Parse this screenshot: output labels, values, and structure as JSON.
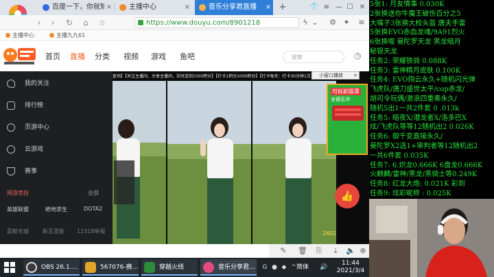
{
  "browser": {
    "tabs": [
      {
        "label": "百度一下，你就知道",
        "active": false
      },
      {
        "label": "主播中心",
        "active": false
      },
      {
        "label": "音乐分享君直播",
        "active": true
      }
    ],
    "close_glyph": "×",
    "new_tab_glyph": "+",
    "url": "https://www.douyu.com/8901218",
    "bookmarks": [
      "主播中心",
      "主播九九61"
    ]
  },
  "site": {
    "nav": [
      "首页",
      "直播",
      "分类",
      "视频",
      "游戏",
      "鱼吧"
    ],
    "active_nav": "直播",
    "search_placeholder": "搜索",
    "accent_color": "#ff5d23"
  },
  "sidebar": {
    "items": [
      "我的关注",
      "排行榜",
      "页游中心",
      "云游戏",
      "赛事"
    ],
    "section_title": "网游竞技",
    "section_all": "全部",
    "games": [
      "英雄联盟",
      "绝地求生",
      "DOTA2"
    ],
    "footer": [
      "蓝鲸长城",
      "斯瓦里斯",
      "12318举报"
    ]
  },
  "player": {
    "danmu": "查询】【关注主播间，分享主播间，实时送到1000积分】【打卡1积分1000积分】【打卡每天：打卡30分钟1次】【打卡每天分享",
    "mini_window_label": "小窗口播放",
    "ad_title": "可拆卸面罩",
    "ad_sub": "全键无冲",
    "rank_badge": "2602"
  },
  "task_panel": {
    "lines": [
      "5张1: 月友情事 0.030K",
      "2张换送你牛魔王破伤百分之5",
      "大嘴子3张换大校头盔 唐夫手雷",
      "5张换EVO赤血龙魂/9A91烈火",
      "6张换噬 曼陀罗天龙 黑龙暗月",
      "秘银天龙",
      "任务2: 荣耀铁骑 0.088K",
      "任务3: 雷神精月皮肤 0.100K",
      "任务4: EVO翔云永久+随机闪光弹",
      "飞虎队/唐刀盛世太平/cop赤龙/",
      "胡司令玩偶/激浪四重奏永久/",
      "随机5出1一共2件套 0 .013k",
      "任务5: 暗夜X/潜龙者X/洛多巴X",
      "炫/飞虎队等等12随机出2 0.026K",
      "任务6: 御千变直接永久/",
      "曼陀罗X2选1+审判者等12随机出2",
      "一共6件套 0.035K",
      "任务7: 6.炽龙0.666K 6盘龙0.666K",
      "火麒麟/雷神/黑龙/黑骑士等0.249K",
      "任务8: 红龙大炮: 0.021K 彩到",
      "任务9: 炫彩昵称 : 0.025K"
    ],
    "text_color": "#27e23a"
  },
  "taskbar": {
    "apps": [
      {
        "label": "OBS 26.1.…",
        "color": "#3a3a3a"
      },
      {
        "label": "567076-赛…",
        "color": "#e0a526"
      },
      {
        "label": "穿越火线",
        "color": "#2d8a3a"
      },
      {
        "label": "音乐分享君…",
        "color": "#e44b7f"
      }
    ],
    "ime": "简体",
    "time": "11:44",
    "date": "2021/3/4"
  }
}
